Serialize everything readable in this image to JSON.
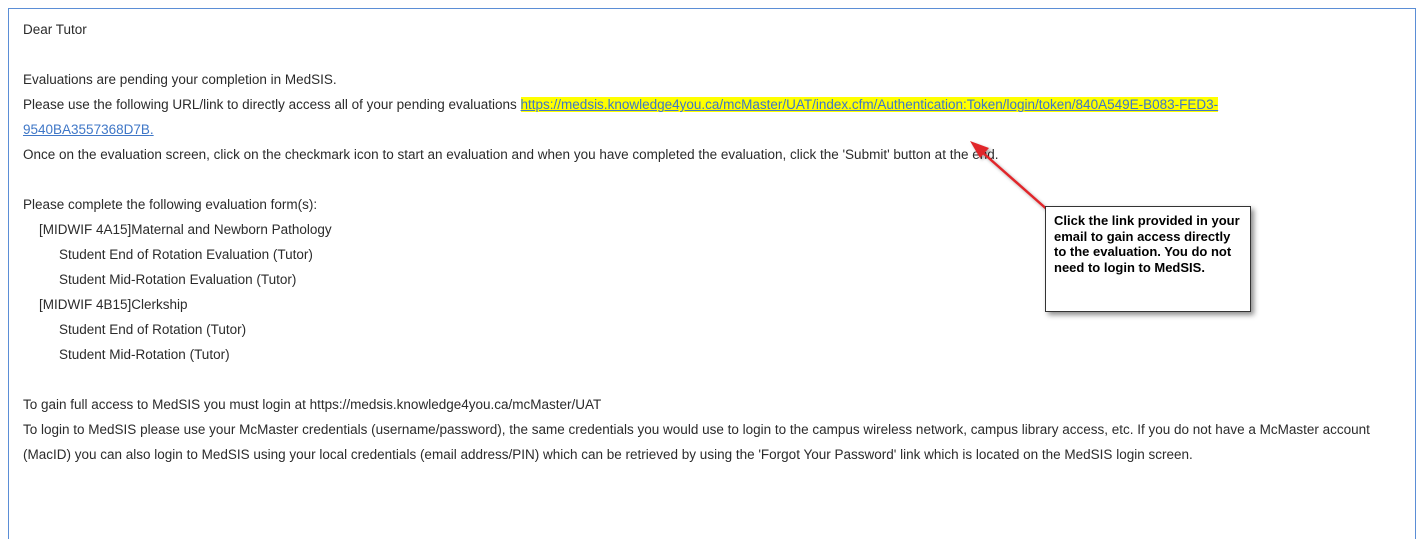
{
  "email": {
    "greeting": "Dear  Tutor",
    "pending_line": "Evaluations are pending your completion in MedSIS.",
    "url_intro": "Please use the following URL/link to directly access all of your pending evaluations ",
    "url_part1": "https://medsis.knowledge4you.ca/mcMaster/UAT/index.cfm/Authentication:Token/login/token/840A549E-B083-FED3-",
    "url_part2": "9540BA3557368D7B",
    "url_end": ".",
    "instructions": "Once on the evaluation screen, click on the checkmark icon to start an evaluation and when you have completed the evaluation, click the 'Submit' button at the end.",
    "forms_heading": "Please complete the following evaluation form(s):",
    "courses": [
      {
        "name": "[MIDWIF 4A15]Maternal and Newborn Pathology",
        "forms": [
          "Student End of Rotation Evaluation (Tutor)",
          "Student Mid-Rotation Evaluation (Tutor)"
        ]
      },
      {
        "name": "[MIDWIF 4B15]Clerkship",
        "forms": [
          "Student End of Rotation (Tutor)",
          "Student Mid-Rotation (Tutor)"
        ]
      }
    ],
    "full_access": "To gain full access to MedSIS you must login at https://medsis.knowledge4you.ca/mcMaster/UAT",
    "login_help": "To login to MedSIS please use your McMaster credentials (username/password), the same credentials you would use to login to the campus wireless network, campus library access, etc. If you do not have a McMaster account (MacID) you can also login to MedSIS using your local credentials (email address/PIN) which can be retrieved by using the 'Forgot Your Password' link which is located on the MedSIS login screen."
  },
  "callout": {
    "text": "Click the link provided in your email to gain access directly to the evaluation.  You do not need to login to MedSIS."
  },
  "colors": {
    "link": "#3f77c7",
    "highlight": "#ffff00",
    "arrow": "#e0262b",
    "frame_border": "#5b8ed6"
  }
}
